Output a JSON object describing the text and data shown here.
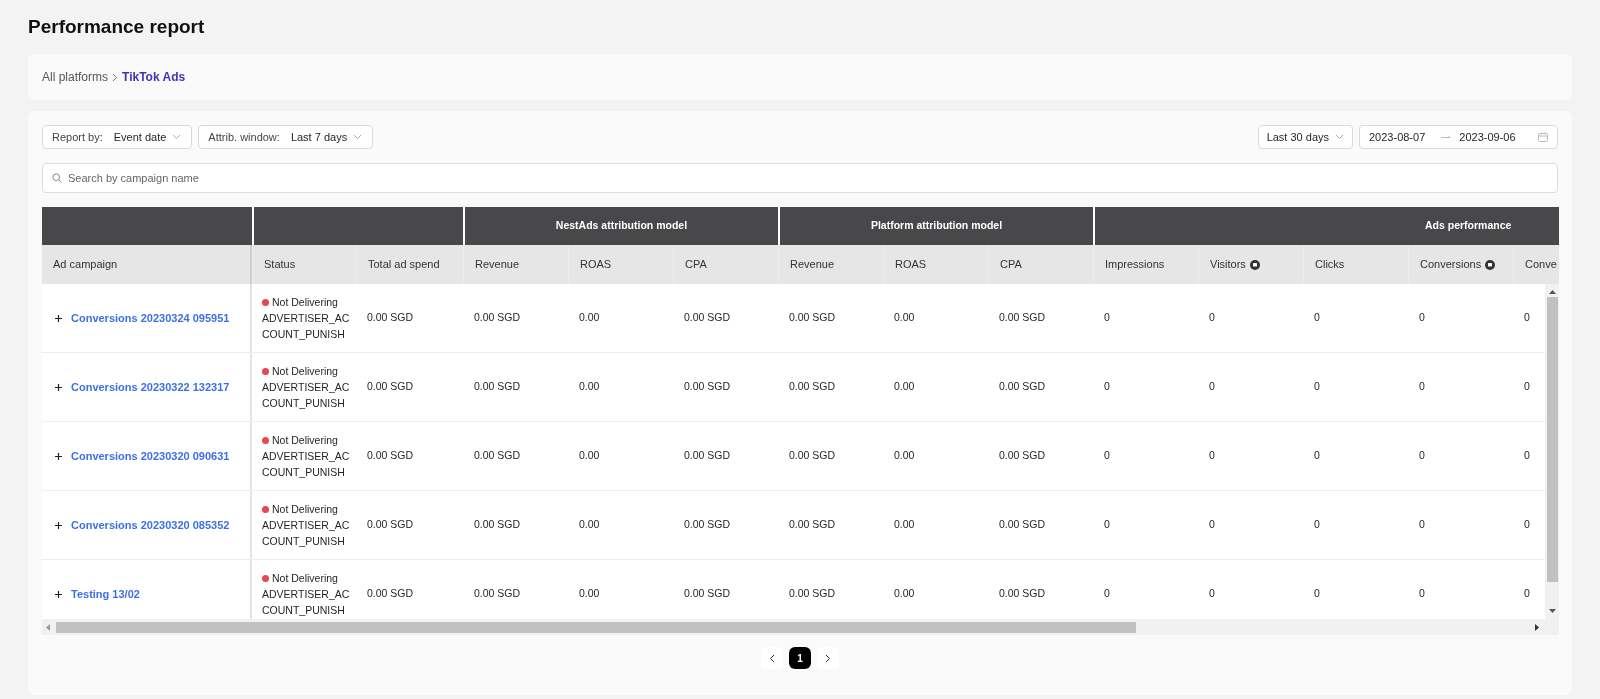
{
  "title": "Performance report",
  "breadcrumb": [
    {
      "label": "All platforms",
      "current": false
    },
    {
      "label": "TikTok Ads",
      "current": true
    }
  ],
  "filters": [
    {
      "label": "Report by:",
      "value": "Event date"
    },
    {
      "label": "Attrib. window:",
      "value": "Last 7 days"
    }
  ],
  "date_range": {
    "preset": "Last 30 days",
    "start": "2023-08-07",
    "end": "2023-09-06"
  },
  "search": {
    "placeholder": "Search by campaign name"
  },
  "table": {
    "column_groups": [
      {
        "columns": [
          {
            "label": "Ad campaign",
            "info": false
          }
        ]
      },
      {
        "columns": [
          {
            "label": "Status",
            "info": false
          },
          {
            "label": "Total ad spend",
            "info": false
          }
        ]
      },
      {
        "label": "NestAds attribution model",
        "columns": [
          {
            "label": "Revenue",
            "info": false
          },
          {
            "label": "ROAS",
            "info": false
          },
          {
            "label": "CPA",
            "info": false
          }
        ]
      },
      {
        "label": "Platform attribution model",
        "columns": [
          {
            "label": "Revenue",
            "info": false
          },
          {
            "label": "ROAS",
            "info": false
          },
          {
            "label": "CPA",
            "info": false
          }
        ]
      },
      {
        "label": "Ads performance",
        "columns": [
          {
            "label": "Impressions",
            "info": false
          },
          {
            "label": "Visitors",
            "info": true
          },
          {
            "label": "Clicks",
            "info": false
          },
          {
            "label": "Conversions",
            "info": true
          },
          {
            "label": "Conve",
            "info": false
          }
        ]
      }
    ],
    "rows": [
      {
        "campaign": "Conversions 20230324 095951",
        "status": "Not Delivering",
        "status_detail": "ADVERTISER_AC COUNT_PUNISH",
        "cells": [
          "0.00 SGD",
          "0.00 SGD",
          "0.00",
          "0.00 SGD",
          "0.00 SGD",
          "0.00",
          "0.00 SGD",
          "0",
          "0",
          "0",
          "0",
          "0"
        ]
      },
      {
        "campaign": "Conversions 20230322 132317",
        "status": "Not Delivering",
        "status_detail": "ADVERTISER_AC COUNT_PUNISH",
        "cells": [
          "0.00 SGD",
          "0.00 SGD",
          "0.00",
          "0.00 SGD",
          "0.00 SGD",
          "0.00",
          "0.00 SGD",
          "0",
          "0",
          "0",
          "0",
          "0"
        ]
      },
      {
        "campaign": "Conversions 20230320 090631",
        "status": "Not Delivering",
        "status_detail": "ADVERTISER_AC COUNT_PUNISH",
        "cells": [
          "0.00 SGD",
          "0.00 SGD",
          "0.00",
          "0.00 SGD",
          "0.00 SGD",
          "0.00",
          "0.00 SGD",
          "0",
          "0",
          "0",
          "0",
          "0"
        ]
      },
      {
        "campaign": "Conversions 20230320 085352",
        "status": "Not Delivering",
        "status_detail": "ADVERTISER_AC COUNT_PUNISH",
        "cells": [
          "0.00 SGD",
          "0.00 SGD",
          "0.00",
          "0.00 SGD",
          "0.00 SGD",
          "0.00",
          "0.00 SGD",
          "0",
          "0",
          "0",
          "0",
          "0"
        ]
      },
      {
        "campaign": "Testing 13/02",
        "status": "Not Delivering",
        "status_detail": "ADVERTISER_AC COUNT_PUNISH",
        "cells": [
          "0.00 SGD",
          "0.00 SGD",
          "0.00",
          "0.00 SGD",
          "0.00 SGD",
          "0.00",
          "0.00 SGD",
          "0",
          "0",
          "0",
          "0",
          "0"
        ]
      }
    ]
  },
  "pagination": {
    "pages": [
      {
        "label": "1",
        "selected": true
      }
    ]
  }
}
